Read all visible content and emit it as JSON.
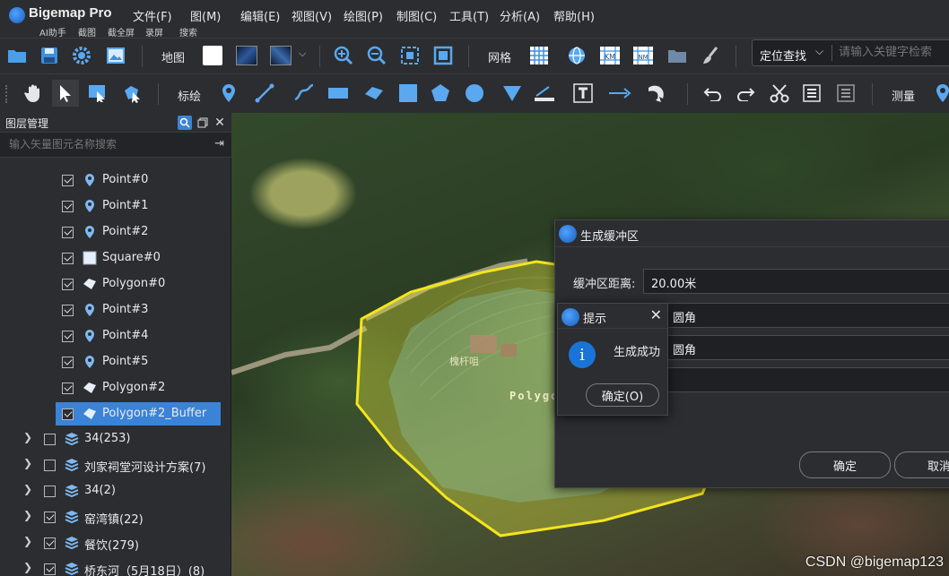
{
  "app": {
    "title": "Bigemap Pro",
    "quick_actions": [
      "AI助手",
      "截图",
      "截全屏",
      "录屏",
      "搜索"
    ]
  },
  "menu": [
    "文件(F)",
    "图(M)",
    "编辑(E)",
    "视图(V)",
    "绘图(P)",
    "制图(C)",
    "工具(T)",
    "分析(A)",
    "帮助(H)"
  ],
  "toolbar1": {
    "map_label": "地图",
    "grid_label": "网格",
    "search_mode": "定位查找",
    "search_placeholder": "请输入关键字检索"
  },
  "toolbar2": {
    "label_label": "标绘",
    "measure_label": "测量"
  },
  "layer_panel": {
    "title": "图层管理",
    "search_placeholder": "输入矢量图元名称搜索",
    "items": [
      {
        "label": "Point#0",
        "icon": "point-pin-icon",
        "checked": true
      },
      {
        "label": "Point#1",
        "icon": "point-pin-icon",
        "checked": true
      },
      {
        "label": "Point#2",
        "icon": "point-pin-icon",
        "checked": true
      },
      {
        "label": "Square#0",
        "icon": "square-icon",
        "checked": true
      },
      {
        "label": "Polygon#0",
        "icon": "polygon-icon",
        "checked": true
      },
      {
        "label": "Point#3",
        "icon": "point-pin-icon",
        "checked": true
      },
      {
        "label": "Point#4",
        "icon": "point-pin-icon",
        "checked": true
      },
      {
        "label": "Point#5",
        "icon": "point-pin-icon",
        "checked": true
      },
      {
        "label": "Polygon#2",
        "icon": "polygon-icon",
        "checked": true
      },
      {
        "label": "Polygon#2_Buffer",
        "icon": "polygon-icon",
        "checked": true,
        "selected": true
      }
    ],
    "groups": [
      {
        "label": "34(253)",
        "checked": false
      },
      {
        "label": "刘家祠堂河设计方案(7)",
        "checked": false
      },
      {
        "label": "34(2)",
        "checked": false
      },
      {
        "label": "窑湾镇(22)",
        "checked": true
      },
      {
        "label": "餐饮(279)",
        "checked": true
      },
      {
        "label": "桥东河（5月18日）(8)",
        "checked": true
      }
    ]
  },
  "map": {
    "polygon_label": "Polygo",
    "place_label": "槐杆咀",
    "watermark": "CSDN @bigemap123"
  },
  "buffer_dialog": {
    "title": "生成缓冲区",
    "distance_label": "缓冲区距离:",
    "distance_value": "20.00米",
    "corner_value_1": "圆角",
    "corner_value_2": "圆角",
    "ok_label": "确定",
    "cancel_label": "取消"
  },
  "info_dialog": {
    "title": "提示",
    "message": "生成成功",
    "ok_label": "确定(O)"
  },
  "colors": {
    "accent": "#3b83d6",
    "buffer_outline": "#f5e51c",
    "annotation_arrow": "#e01414"
  }
}
